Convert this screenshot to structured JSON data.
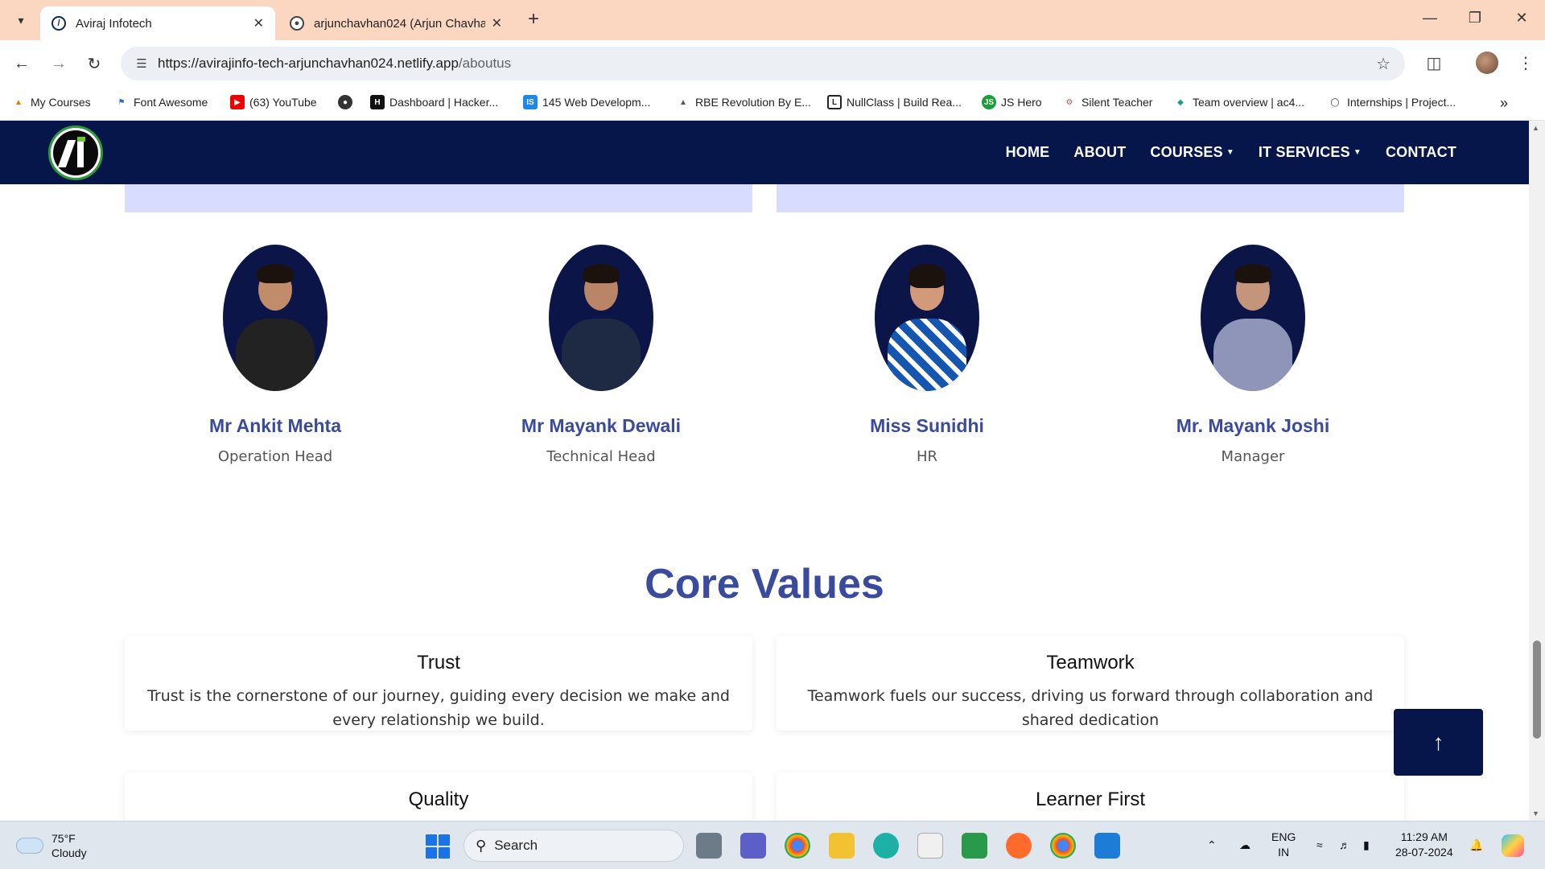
{
  "browser": {
    "tabs": [
      {
        "title": "Aviraj Infotech"
      },
      {
        "title": "arjunchavhan024 (Arjun Chavhan)"
      }
    ],
    "url_host": "https://avirajinfo-tech-arjunchavhan024.netlify.app",
    "url_path": "/aboutus",
    "bookmarks": [
      {
        "label": "My Courses"
      },
      {
        "label": "Font Awesome"
      },
      {
        "label": "(63) YouTube"
      },
      {
        "label": ""
      },
      {
        "label": "Dashboard | Hacker..."
      },
      {
        "label": "145 Web Developm..."
      },
      {
        "label": "RBE Revolution By E..."
      },
      {
        "label": "NullClass | Build Rea..."
      },
      {
        "label": "JS Hero"
      },
      {
        "label": "Silent Teacher"
      },
      {
        "label": "Team overview | ac4..."
      },
      {
        "label": "Internships | Project..."
      }
    ]
  },
  "site": {
    "nav": {
      "home": "HOME",
      "about": "ABOUT",
      "courses": "COURSES",
      "it_services": "IT SERVICES",
      "contact": "CONTACT"
    },
    "team": [
      {
        "name": "Mr Ankit Mehta",
        "role": "Operation Head"
      },
      {
        "name": "Mr Mayank Dewali",
        "role": "Technical Head"
      },
      {
        "name": "Miss Sunidhi",
        "role": "HR"
      },
      {
        "name": "Mr. Mayank Joshi",
        "role": "Manager"
      }
    ],
    "core_values_title": "Core Values",
    "core_values": [
      {
        "title": "Trust",
        "desc": "Trust is the cornerstone of our journey, guiding every decision we make and every relationship we build."
      },
      {
        "title": "Teamwork",
        "desc": "Teamwork fuels our success, driving us forward through collaboration and shared dedication"
      },
      {
        "title": "Quality",
        "desc": ""
      },
      {
        "title": "Learner First",
        "desc": ""
      }
    ],
    "colors": {
      "navy": "#06154a",
      "accent": "#3a4a9c",
      "lilac": "#d8dcff"
    }
  },
  "taskbar": {
    "weather_temp": "75°F",
    "weather_text": "Cloudy",
    "search_label": "Search",
    "lang_top": "ENG",
    "lang_bottom": "IN",
    "time": "11:29 AM",
    "date": "28-07-2024"
  }
}
